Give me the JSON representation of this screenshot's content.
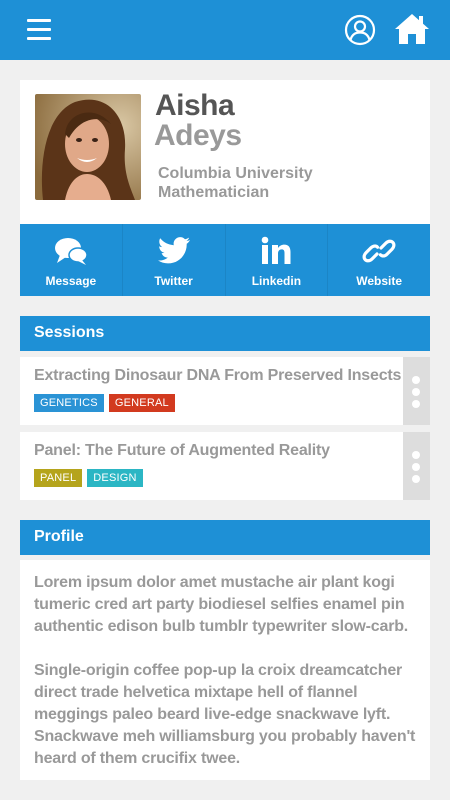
{
  "header": {
    "menu_icon": "hamburger-menu-icon",
    "user_icon": "user-circle-icon",
    "home_icon": "home-icon",
    "color": "#1e90d6"
  },
  "speaker": {
    "first_name": "Aisha",
    "last_name": "Adeys",
    "organization": "Columbia University",
    "role": "Mathematician"
  },
  "social": [
    {
      "label": "Message",
      "icon": "chat-bubbles-icon"
    },
    {
      "label": "Twitter",
      "icon": "twitter-bird-icon"
    },
    {
      "label": "Linkedin",
      "icon": "linkedin-icon"
    },
    {
      "label": "Website",
      "icon": "link-chain-icon"
    }
  ],
  "sessions": {
    "header": "Sessions",
    "items": [
      {
        "title": "Extracting Dinosaur DNA From Preserved Insects",
        "tags": [
          {
            "label": "GENETICS",
            "color": "#2a93d5"
          },
          {
            "label": "GENERAL",
            "color": "#d23a1f"
          }
        ]
      },
      {
        "title": "Panel: The Future of Augmented Reality",
        "tags": [
          {
            "label": "PANEL",
            "color": "#b5a41c"
          },
          {
            "label": "DESIGN",
            "color": "#2bb6c4"
          }
        ]
      }
    ]
  },
  "profile": {
    "header": "Profile",
    "paragraphs": [
      "Lorem ipsum dolor amet mustache air plant kogi tumeric cred art party biodiesel selfies enamel pin authentic edison bulb tumblr typewriter slow-carb.",
      "Single-origin coffee pop-up la croix dreamcatcher direct trade helvetica mixtape hell of flannel meggings paleo beard live-edge snackwave lyft. Snackwave meh williamsburg you probably haven't heard of them crucifix twee."
    ]
  }
}
